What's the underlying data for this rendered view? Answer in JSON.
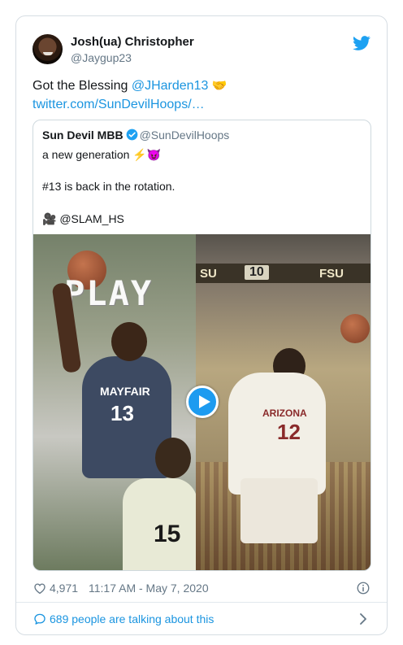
{
  "author": {
    "name": "Josh(ua) Christopher",
    "handle": "@Jaygup23"
  },
  "tweet": {
    "text_prefix": "Got the Blessing ",
    "mention": "@JHarden13",
    "emoji": "🤝",
    "link": "twitter.com/SunDevilHoops/…"
  },
  "quoted": {
    "name": "Sun Devil MBB",
    "handle": "@SunDevilHoops",
    "line1_text": "a new generation ",
    "line1_emoji": "⚡😈",
    "line2": "#13 is back in the rotation.",
    "line3_emoji": "🎥",
    "line3_text": " @SLAM_HS"
  },
  "media": {
    "overlay_word": "PLAY",
    "left_jersey": "MAYFAIR",
    "left_number": "13",
    "front_number": "15",
    "score_left": "SU",
    "score_mid": "10",
    "score_right": "FSU",
    "right_jersey": "ARIZONA",
    "right_number": "12"
  },
  "meta": {
    "likes": "4,971",
    "timestamp": "11:17 AM - May 7, 2020"
  },
  "footer": {
    "talking": "689 people are talking about this"
  },
  "colors": {
    "link": "#1b95e0",
    "twitter_blue": "#1da1f2",
    "muted": "#657786"
  }
}
